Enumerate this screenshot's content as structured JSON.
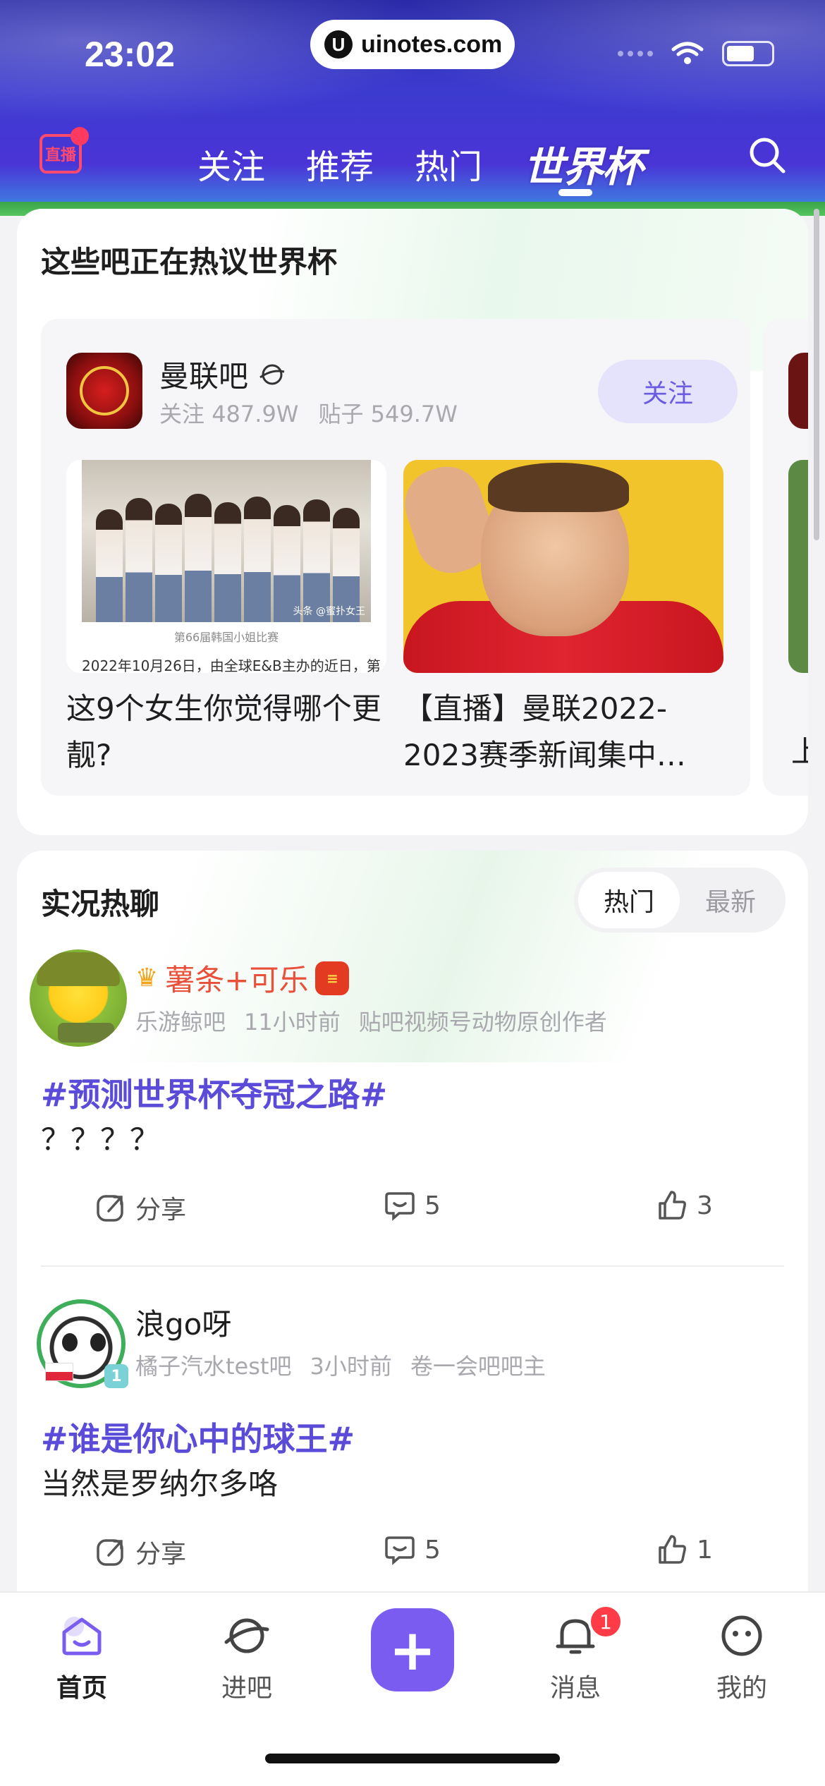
{
  "status_bar": {
    "time": "23:02",
    "url": "uinotes.com"
  },
  "header": {
    "live_label": "直播",
    "tabs": [
      "关注",
      "推荐",
      "热门",
      "世界杯"
    ],
    "active_tab": "世界杯"
  },
  "hot_forums": {
    "title": "这些吧正在热议世界杯",
    "forum": {
      "name": "曼联吧",
      "followers_label": "关注",
      "followers": "487.9W",
      "posts_label": "贴子",
      "posts": "549.7W",
      "follow_button": "关注"
    },
    "posts": [
      {
        "title": "这9个女生你觉得哪个更靓?",
        "caption_top": "第66届韩国小姐比赛",
        "caption_bottom": "2022年10月26日，由全球E&B主办的近日，第",
        "watermark": "头条 @蜜扑女王"
      },
      {
        "title": "【直播】曼联2022-2023赛季新闻集中…"
      }
    ],
    "next_post_peek": "上"
  },
  "live_chat": {
    "title": "实况热聊",
    "sort_tabs": [
      "热门",
      "最新"
    ],
    "active_sort": "热门",
    "items": [
      {
        "username": "薯条+可乐",
        "forum": "乐游鲸吧",
        "time": "11小时前",
        "role": "贴吧视频号动物原创作者",
        "topic": "#预测世界杯夺冠之路#",
        "content": "？？？？",
        "share_label": "分享",
        "comments": "5",
        "likes": "3"
      },
      {
        "username": "浪go呀",
        "level": "1",
        "forum": "橘子汽水test吧",
        "time": "3小时前",
        "role": "卷一会吧吧主",
        "topic": "#谁是你心中的球王#",
        "content": "当然是罗纳尔多咯",
        "share_label": "分享",
        "comments": "5",
        "likes": "1"
      }
    ]
  },
  "tabbar": {
    "items": [
      "首页",
      "进吧",
      "消息",
      "我的"
    ],
    "active": "首页",
    "message_badge": "1",
    "post_button": "+"
  },
  "colors": {
    "accent": "#7b5cf0",
    "topic": "#5a4cd8",
    "vip_name": "#e8503a",
    "badge": "#ff3b47"
  }
}
